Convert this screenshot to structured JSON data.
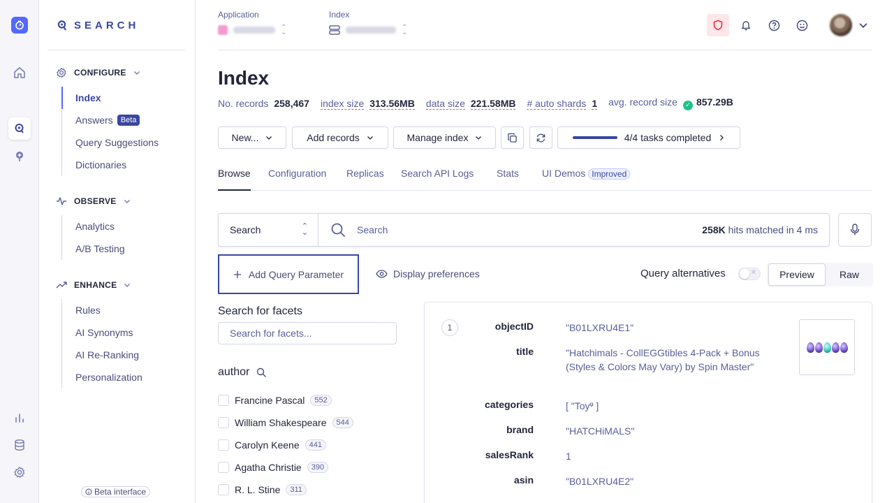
{
  "brand": {
    "name": "SEARCH",
    "beta_interface": "Beta interface"
  },
  "sidebar": {
    "sections": [
      {
        "label": "CONFIGURE",
        "items": [
          {
            "label": "Index",
            "active": true
          },
          {
            "label": "Answers",
            "badge": "Beta"
          },
          {
            "label": "Query Suggestions"
          },
          {
            "label": "Dictionaries"
          }
        ]
      },
      {
        "label": "OBSERVE",
        "items": [
          {
            "label": "Analytics"
          },
          {
            "label": "A/B Testing"
          }
        ]
      },
      {
        "label": "ENHANCE",
        "items": [
          {
            "label": "Rules"
          },
          {
            "label": "AI Synonyms"
          },
          {
            "label": "AI Re-Ranking"
          },
          {
            "label": "Personalization"
          }
        ]
      }
    ]
  },
  "topbar": {
    "application_label": "Application",
    "index_label": "Index"
  },
  "page": {
    "title": "Index",
    "stats": [
      {
        "label": "No. records",
        "value": "258,467"
      },
      {
        "label": "index size",
        "value": "313.56MB"
      },
      {
        "label": "data size",
        "value": "221.58MB"
      },
      {
        "label": "# auto shards",
        "value": "1"
      },
      {
        "label": "avg. record size",
        "value": "857.29B"
      }
    ]
  },
  "toolbar": {
    "new_label": "New...",
    "add_records_label": "Add records",
    "manage_index_label": "Manage index",
    "tasks_label": "4/4 tasks completed",
    "tasks_progress": 1.0
  },
  "tabs": [
    {
      "label": "Browse",
      "active": true
    },
    {
      "label": "Configuration"
    },
    {
      "label": "Replicas"
    },
    {
      "label": "Search API Logs"
    },
    {
      "label": "Stats"
    },
    {
      "label": "UI Demos",
      "tag": "Improved"
    }
  ],
  "search": {
    "mode": "Search",
    "placeholder": "Search",
    "hits_count": "258K",
    "hits_suffix": " hits matched in 4 ms"
  },
  "controls": {
    "add_query_parameter": "Add Query Parameter",
    "display_preferences": "Display preferences",
    "query_alternatives": "Query alternatives",
    "preview": "Preview",
    "raw": "Raw"
  },
  "facets": {
    "title": "Search for facets",
    "placeholder": "Search for facets...",
    "attribute": "author",
    "values": [
      {
        "label": "Francine Pascal",
        "count": "552"
      },
      {
        "label": "William Shakespeare",
        "count": "544"
      },
      {
        "label": "Carolyn Keene",
        "count": "441"
      },
      {
        "label": "Agatha Christie",
        "count": "390"
      },
      {
        "label": "R. L. Stine",
        "count": "311"
      }
    ]
  },
  "hit": {
    "number": "1",
    "attributes": [
      {
        "key": "objectID",
        "value": "\"B01LXRU4E1\""
      },
      {
        "key": "title",
        "value": "\"Hatchimals - CollEGGtibles 4-Pack + Bonus (Styles & Colors May Vary) by Spin Master\""
      },
      {
        "key": "categories",
        "value": "[ \"Toy\" ]"
      },
      {
        "key": "brand",
        "value": "\"HATCHiMALS\""
      },
      {
        "key": "salesRank",
        "value": "1"
      },
      {
        "key": "asin",
        "value": "\"B01LXRU4E2\""
      },
      {
        "key": "",
        "value": "\"\""
      }
    ]
  },
  "colors": {
    "accent": "#3a46a1",
    "brand": "#5468ff",
    "success": "#1fc28b",
    "danger": "#ee243c"
  }
}
